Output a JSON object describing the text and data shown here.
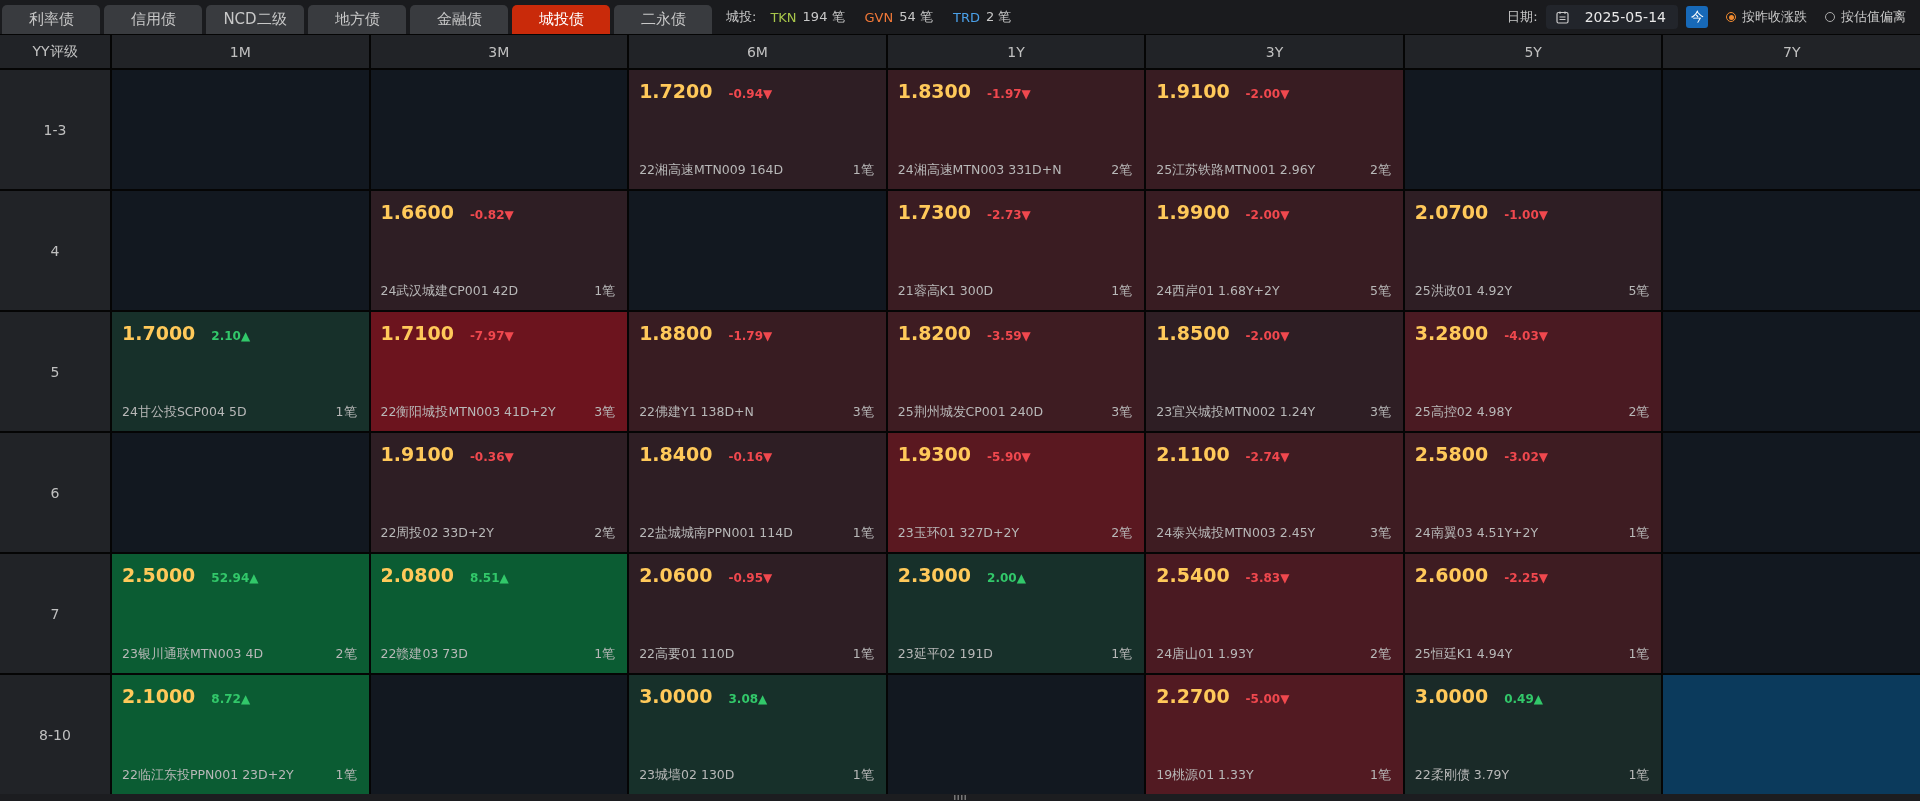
{
  "tabs": [
    {
      "label": "利率债",
      "selected": false
    },
    {
      "label": "信用债",
      "selected": false
    },
    {
      "label": "NCD二级",
      "selected": false
    },
    {
      "label": "地方债",
      "selected": false
    },
    {
      "label": "金融债",
      "selected": false
    },
    {
      "label": "城投债",
      "selected": true
    },
    {
      "label": "二永债",
      "selected": false
    }
  ],
  "summary": {
    "label": "城投:",
    "items": [
      {
        "code": "TKN",
        "count": "194 笔",
        "color": "#a8c64a"
      },
      {
        "code": "GVN",
        "count": "54 笔",
        "color": "#f07838"
      },
      {
        "code": "TRD",
        "count": "2 笔",
        "color": "#4aa0e8"
      }
    ]
  },
  "date": {
    "label": "日期:",
    "value": "2025-05-14",
    "today_button": "今"
  },
  "radios": [
    {
      "label": "按昨收涨跌",
      "selected": true
    },
    {
      "label": "按估值偏离",
      "selected": false
    }
  ],
  "grid": {
    "corner": "YY评级",
    "columns": [
      "1M",
      "3M",
      "6M",
      "1Y",
      "3Y",
      "5Y",
      "7Y"
    ],
    "rows": [
      {
        "rating": "1-3",
        "cells": [
          {
            "kind": "empty",
            "selected": false
          },
          {
            "kind": "empty",
            "selected": false
          },
          {
            "kind": "down",
            "selected": false,
            "color": "#2e1e24",
            "yield": "1.7200",
            "change": "-0.94▼",
            "name": "22湘高速MTN009 164D",
            "trades": "1笔"
          },
          {
            "kind": "down",
            "selected": false,
            "color": "#381c22",
            "yield": "1.8300",
            "change": "-1.97▼",
            "name": "24湘高速MTN003 331D+N",
            "trades": "2笔"
          },
          {
            "kind": "down",
            "selected": false,
            "color": "#381c22",
            "yield": "1.9100",
            "change": "-2.00▼",
            "name": "25江苏铁路MTN001 2.96Y",
            "trades": "2笔"
          },
          {
            "kind": "empty",
            "selected": false
          },
          {
            "kind": "empty",
            "selected": false
          }
        ]
      },
      {
        "rating": "4",
        "cells": [
          {
            "kind": "empty",
            "selected": false
          },
          {
            "kind": "down",
            "selected": false,
            "color": "#2e1e24",
            "yield": "1.6600",
            "change": "-0.82▼",
            "name": "24武汉城建CP001 42D",
            "trades": "1笔"
          },
          {
            "kind": "empty",
            "selected": false
          },
          {
            "kind": "down",
            "selected": false,
            "color": "#3a1c22",
            "yield": "1.7300",
            "change": "-2.73▼",
            "name": "21蓉高K1 300D",
            "trades": "1笔"
          },
          {
            "kind": "down",
            "selected": false,
            "color": "#381c22",
            "yield": "1.9900",
            "change": "-2.00▼",
            "name": "24西岸01 1.68Y+2Y",
            "trades": "5笔"
          },
          {
            "kind": "down",
            "selected": false,
            "color": "#2e1e24",
            "yield": "2.0700",
            "change": "-1.00▼",
            "name": "25洪政01 4.92Y",
            "trades": "5笔"
          },
          {
            "kind": "empty",
            "selected": false
          }
        ]
      },
      {
        "rating": "5",
        "cells": [
          {
            "kind": "up",
            "selected": false,
            "color": "#17302a",
            "yield": "1.7000",
            "change": "2.10▲",
            "name": "24甘公投SCP004 5D",
            "trades": "1笔"
          },
          {
            "kind": "down",
            "selected": false,
            "color": "#6c141e",
            "yield": "1.7100",
            "change": "-7.97▼",
            "name": "22衡阳城投MTN003 41D+2Y",
            "trades": "3笔"
          },
          {
            "kind": "down",
            "selected": false,
            "color": "#381c22",
            "yield": "1.8800",
            "change": "-1.79▼",
            "name": "22佛建Y1 138D+N",
            "trades": "3笔"
          },
          {
            "kind": "down",
            "selected": false,
            "color": "#3e1c22",
            "yield": "1.8200",
            "change": "-3.59▼",
            "name": "25荆州城发CP001 240D",
            "trades": "3笔"
          },
          {
            "kind": "down",
            "selected": false,
            "color": "#2e1e24",
            "yield": "1.8500",
            "change": "-2.00▼",
            "name": "23宜兴城投MTN002 1.24Y",
            "trades": "3笔"
          },
          {
            "kind": "down",
            "selected": false,
            "color": "#4a1a22",
            "yield": "3.2800",
            "change": "-4.03▼",
            "name": "25高控02 4.98Y",
            "trades": "2笔"
          },
          {
            "kind": "empty",
            "selected": false
          }
        ]
      },
      {
        "rating": "6",
        "cells": [
          {
            "kind": "empty",
            "selected": false
          },
          {
            "kind": "down",
            "selected": false,
            "color": "#2e1e24",
            "yield": "1.9100",
            "change": "-0.36▼",
            "name": "22周投02 33D+2Y",
            "trades": "2笔"
          },
          {
            "kind": "down",
            "selected": false,
            "color": "#2e1e24",
            "yield": "1.8400",
            "change": "-0.16▼",
            "name": "22盐城城南PPN001 114D",
            "trades": "1笔"
          },
          {
            "kind": "down",
            "selected": false,
            "color": "#5a1820",
            "yield": "1.9300",
            "change": "-5.90▼",
            "name": "23玉环01 327D+2Y",
            "trades": "2笔"
          },
          {
            "kind": "down",
            "selected": false,
            "color": "#3e1c22",
            "yield": "2.1100",
            "change": "-2.74▼",
            "name": "24泰兴城投MTN003 2.45Y",
            "trades": "3笔"
          },
          {
            "kind": "down",
            "selected": false,
            "color": "#3e1c22",
            "yield": "2.5800",
            "change": "-3.02▼",
            "name": "24南翼03 4.51Y+2Y",
            "trades": "1笔"
          },
          {
            "kind": "empty",
            "selected": false
          }
        ]
      },
      {
        "rating": "7",
        "cells": [
          {
            "kind": "up",
            "selected": false,
            "color": "#0b5c33",
            "yield": "2.5000",
            "change": "52.94▲",
            "name": "23银川通联MTN003 4D",
            "trades": "2笔"
          },
          {
            "kind": "up",
            "selected": false,
            "color": "#0b5c33",
            "yield": "2.0800",
            "change": "8.51▲",
            "name": "22赣建03 73D",
            "trades": "1笔"
          },
          {
            "kind": "down",
            "selected": false,
            "color": "#2e1e24",
            "yield": "2.0600",
            "change": "-0.95▼",
            "name": "22高要01 110D",
            "trades": "1笔"
          },
          {
            "kind": "up",
            "selected": false,
            "color": "#17302a",
            "yield": "2.3000",
            "change": "2.00▲",
            "name": "23延平02 191D",
            "trades": "1笔"
          },
          {
            "kind": "down",
            "selected": false,
            "color": "#4a1a22",
            "yield": "2.5400",
            "change": "-3.83▼",
            "name": "24唐山01 1.93Y",
            "trades": "2笔"
          },
          {
            "kind": "down",
            "selected": false,
            "color": "#3e1c22",
            "yield": "2.6000",
            "change": "-2.25▼",
            "name": "25恒廷K1 4.94Y",
            "trades": "1笔"
          },
          {
            "kind": "empty",
            "selected": false
          }
        ]
      },
      {
        "rating": "8-10",
        "cells": [
          {
            "kind": "up",
            "selected": false,
            "color": "#0b5c33",
            "yield": "2.1000",
            "change": "8.72▲",
            "name": "22临江东投PPN001 23D+2Y",
            "trades": "1笔"
          },
          {
            "kind": "empty",
            "selected": false
          },
          {
            "kind": "up",
            "selected": false,
            "color": "#17302a",
            "yield": "3.0000",
            "change": "3.08▲",
            "name": "23城墙02 130D",
            "trades": "1笔"
          },
          {
            "kind": "empty",
            "selected": false
          },
          {
            "kind": "down",
            "selected": false,
            "color": "#521a22",
            "yield": "2.2700",
            "change": "-5.00▼",
            "name": "19桃源01 1.33Y",
            "trades": "1笔"
          },
          {
            "kind": "up",
            "selected": false,
            "color": "#1a2a28",
            "yield": "3.0000",
            "change": "0.49▲",
            "name": "22柔刚债 3.79Y",
            "trades": "1笔"
          },
          {
            "kind": "empty",
            "selected": true
          }
        ]
      }
    ]
  }
}
